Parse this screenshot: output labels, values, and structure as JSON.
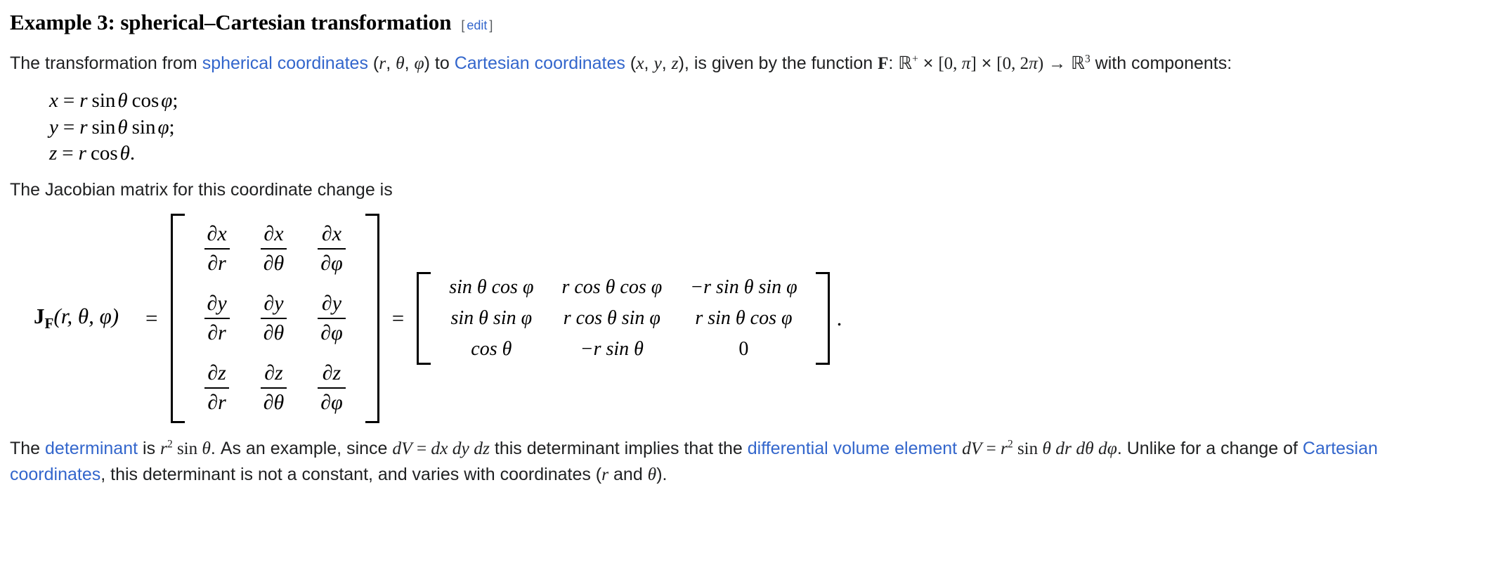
{
  "heading": {
    "title": "Example 3: spherical–Cartesian transformation",
    "edit_bracket_open": "[",
    "edit_label": "edit",
    "edit_bracket_close": "]"
  },
  "intro": {
    "t1": "The transformation from ",
    "link_spherical": "spherical coordinates",
    "t2": " (",
    "var_r": "r",
    "sep1": ", ",
    "var_theta": "θ",
    "sep2": ", ",
    "var_phi": "φ",
    "t3": ") to ",
    "link_cartesian": "Cartesian coordinates",
    "t4": " (",
    "var_x": "x",
    "sep3": ", ",
    "var_y": "y",
    "sep4": ", ",
    "var_z": "z",
    "t5": "), is given by the function ",
    "fn_F": "F",
    "t6": ": ",
    "dom_R": "ℝ",
    "dom_plus": "+",
    "dom_times1": " × ",
    "dom_i1": "[0, ",
    "dom_pi1": "π",
    "dom_i1b": "]",
    "dom_times2": " × ",
    "dom_i2": "[0, 2",
    "dom_pi2": "π",
    "dom_i2b": ")",
    "dom_arrow": " → ",
    "cod_R": "ℝ",
    "cod_exp": "3",
    "t7": " with components:"
  },
  "components": [
    {
      "lhs": "x",
      "eq": "=",
      "coef": "r",
      "f1": "sin",
      "a1": "θ",
      "f2": "cos",
      "a2": "φ",
      "term": ";"
    },
    {
      "lhs": "y",
      "eq": "=",
      "coef": "r",
      "f1": "sin",
      "a1": "θ",
      "f2": "sin",
      "a2": "φ",
      "term": ";"
    },
    {
      "lhs": "z",
      "eq": "=",
      "coef": "r",
      "f1": "cos",
      "a1": "θ",
      "f2": "",
      "a2": "",
      "term": "."
    }
  ],
  "jacobian_lead": "The Jacobian matrix for this coordinate change is",
  "jacobian": {
    "label_J": "J",
    "label_sub": "F",
    "label_args": "(r, θ, φ)",
    "equals_1": "=",
    "equals_2": "=",
    "trailing_period": ".",
    "partials": [
      [
        {
          "num_d": "∂",
          "num_v": "x",
          "den_d": "∂",
          "den_v": "r"
        },
        {
          "num_d": "∂",
          "num_v": "x",
          "den_d": "∂",
          "den_v": "θ"
        },
        {
          "num_d": "∂",
          "num_v": "x",
          "den_d": "∂",
          "den_v": "φ"
        }
      ],
      [
        {
          "num_d": "∂",
          "num_v": "y",
          "den_d": "∂",
          "den_v": "r"
        },
        {
          "num_d": "∂",
          "num_v": "y",
          "den_d": "∂",
          "den_v": "θ"
        },
        {
          "num_d": "∂",
          "num_v": "y",
          "den_d": "∂",
          "den_v": "φ"
        }
      ],
      [
        {
          "num_d": "∂",
          "num_v": "z",
          "den_d": "∂",
          "den_v": "r"
        },
        {
          "num_d": "∂",
          "num_v": "z",
          "den_d": "∂",
          "den_v": "θ"
        },
        {
          "num_d": "∂",
          "num_v": "z",
          "den_d": "∂",
          "den_v": "φ"
        }
      ]
    ],
    "trig": [
      [
        "sin θ cos φ",
        "r cos θ cos φ",
        "−r sin θ sin φ"
      ],
      [
        "sin θ sin φ",
        "r cos θ sin φ",
        "r sin θ cos φ"
      ],
      [
        "cos θ",
        "−r sin θ",
        "0"
      ]
    ]
  },
  "closing": {
    "c1": "The ",
    "link_determinant": "determinant",
    "c2": " is ",
    "det_r": "r",
    "det_exp": "2",
    "det_sin": " sin ",
    "det_theta": "θ",
    "c3": ". As an example, since ",
    "dV": "dV",
    "eq": " = ",
    "dx": "dx",
    "dy": " dy",
    "dz": " dz",
    "c4": " this determinant implies that the ",
    "link_dve": "differential volume element",
    "c5": " ",
    "dV2": "dV",
    "eq2": " = ",
    "r2": "r",
    "r2exp": "2",
    "sin2": " sin ",
    "theta2": "θ",
    "dr": " dr",
    "dtheta": " dθ",
    "dphi": " dφ",
    "c6": ". Unlike for a change of ",
    "link_cartesian2": "Cartesian coordinates",
    "c7": ", this determinant is not a constant, and varies with coordinates (",
    "cr": "r",
    "c8": " and ",
    "ctheta": "θ",
    "c9": ")."
  },
  "colors": {
    "link": "#3366cc",
    "text": "#202122",
    "bracket_gray": "#54595d",
    "background": "#ffffff"
  }
}
